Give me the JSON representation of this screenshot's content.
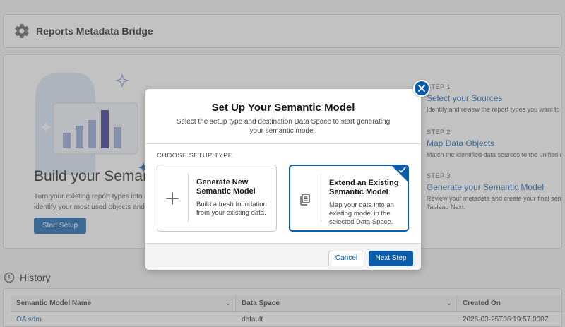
{
  "app": {
    "title": "Reports Metadata Bridge",
    "icon": "gear-icon"
  },
  "hero": {
    "title": "Build your Semantic",
    "description": "Turn your existing report types into act identify your most used objects and sy",
    "start_button": "Start Setup"
  },
  "steps": [
    {
      "number": "STEP 1",
      "title": "Select your Sources",
      "description": "Identify and review the report types you want to us"
    },
    {
      "number": "STEP 2",
      "title": "Map Data Objects",
      "description": "Match the identified data sources to the unified dat"
    },
    {
      "number": "STEP 3",
      "title": "Generate your Semantic Model",
      "description": "Review your metadata and create your final semant",
      "description2": "Tableau Next."
    }
  ],
  "history": {
    "title": "History",
    "columns": [
      "Semantic Model Name",
      "Data Space",
      "Created On"
    ],
    "rows": [
      {
        "name": "OA sdm",
        "data_space": "default",
        "created_on": "2026-03-25T06:19:57.000Z"
      }
    ]
  },
  "modal": {
    "title": "Set Up Your Semantic Model",
    "subtitle": "Select the setup type and destination Data Space to start generating your semantic model.",
    "section_label": "CHOOSE SETUP TYPE",
    "options": [
      {
        "title": "Generate New Semantic Model",
        "description": "Build a fresh foundation from your existing data.",
        "icon": "plus-icon",
        "selected": false
      },
      {
        "title": "Extend an Existing Semantic Model",
        "description": "Map your data into an existing model in the selected Data Space.",
        "icon": "copy-icon",
        "selected": true
      }
    ],
    "cancel_label": "Cancel",
    "next_label": "Next Step"
  },
  "colors": {
    "brand": "#0b5cab",
    "overlay": "rgba(120,120,120,0.45)"
  }
}
